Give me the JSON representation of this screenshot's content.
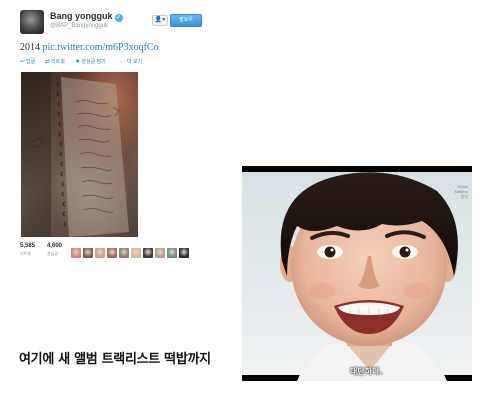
{
  "tweet": {
    "user": {
      "display_name": "Bang yongguk",
      "handle": "@BAP_Bangyongguk",
      "verified_glyph": "✓"
    },
    "header_buttons": {
      "user_actions_label": "👤▾",
      "follow_label": "팔로우"
    },
    "text": {
      "year": "2014",
      "link": "pic.twitter.com/m6P3xoqfCo"
    },
    "actions": [
      {
        "icon": "reply-icon",
        "glyph": "↩",
        "label": "답글"
      },
      {
        "icon": "retweet-icon",
        "glyph": "⇄",
        "label": "리트윗"
      },
      {
        "icon": "star-icon",
        "glyph": "★",
        "label": "관심글 담기"
      },
      {
        "icon": "more-icon",
        "glyph": "···",
        "label": "더 보기"
      }
    ],
    "stats": [
      {
        "value": "5,585",
        "label": "리트윗"
      },
      {
        "value": "4,600",
        "label": "관심글"
      }
    ],
    "favoriter_avatar_colors": [
      "#c98b7a",
      "#7a5c52",
      "#d2a08c",
      "#a06a60",
      "#8a7f76",
      "#d6b7a4",
      "#3f3a3a",
      "#b59d8c",
      "#6e8f8a",
      "#2c2c2c"
    ]
  },
  "caption": "여기에 새 앨범 트랙리스트 떡밥까지",
  "screencap": {
    "watermark": "Music\nMatters\n음악",
    "subtitle": "대단하다."
  },
  "colors": {
    "link": "#2b7bb9",
    "follow_button": "#3b93d8",
    "verified": "#55acee"
  }
}
